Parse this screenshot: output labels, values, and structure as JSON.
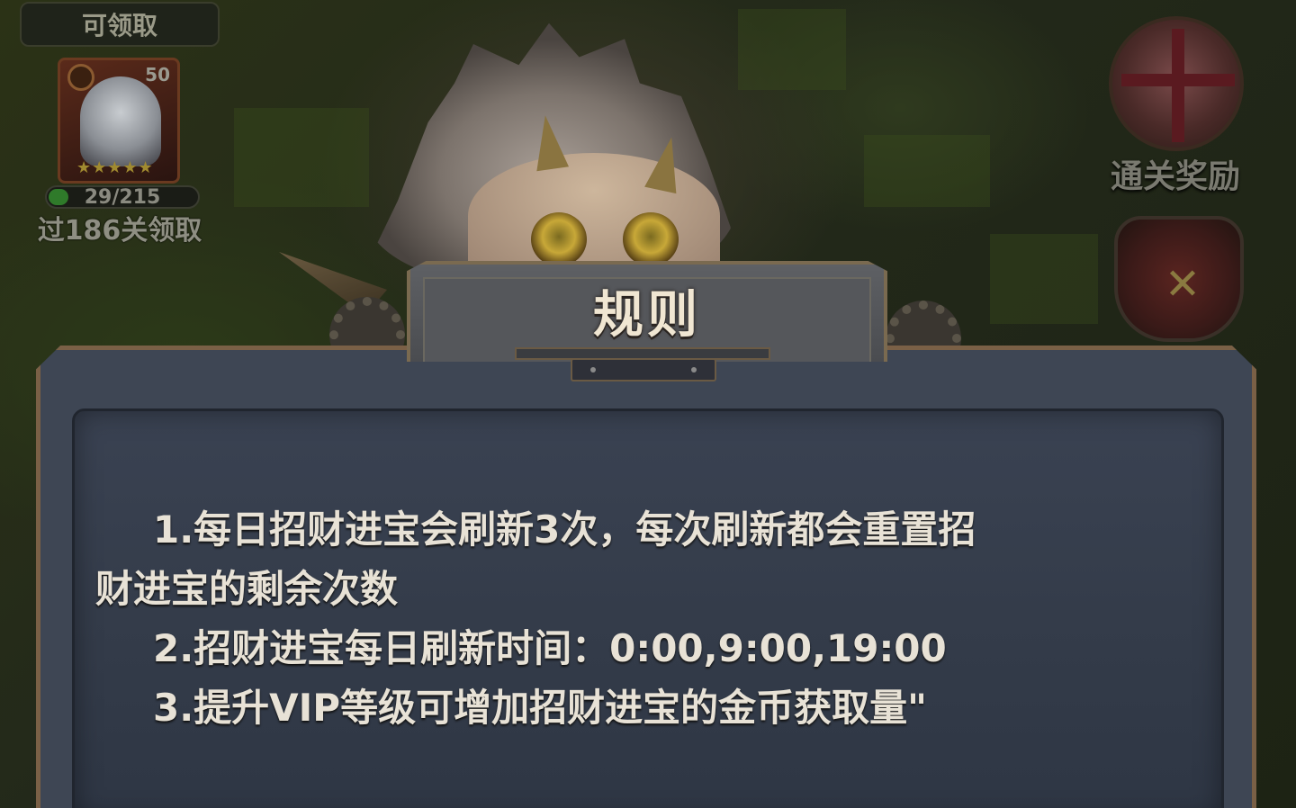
{
  "hud": {
    "claim_tag": "可领取",
    "hero_level": "50",
    "hero_stars": "★★★★★",
    "progress": {
      "current": 29,
      "total": 215,
      "text": "29/215"
    },
    "stage_claim": "过186关领取",
    "clear_reward_label": "通关奖励"
  },
  "dialog": {
    "title": "规则",
    "rules": [
      "1.每日招财进宝会刷新3次，每次刷新都会重置招",
      "财进宝的剩余次数",
      "2.招财进宝每日刷新时间：0:00,9:00,19:00",
      "3.提升VIP等级可增加招财进宝的金币获取量\""
    ]
  },
  "icons": {
    "hero_emblem": "hero-faction-icon",
    "gift": "gift-box-icon",
    "battle": "crossed-swords-shield-icon"
  },
  "colors": {
    "dialog_body": "#3a4252",
    "dialog_border": "#7a6046",
    "title_text": "#f0e6d2",
    "rule_text": "#e8e2d6"
  }
}
